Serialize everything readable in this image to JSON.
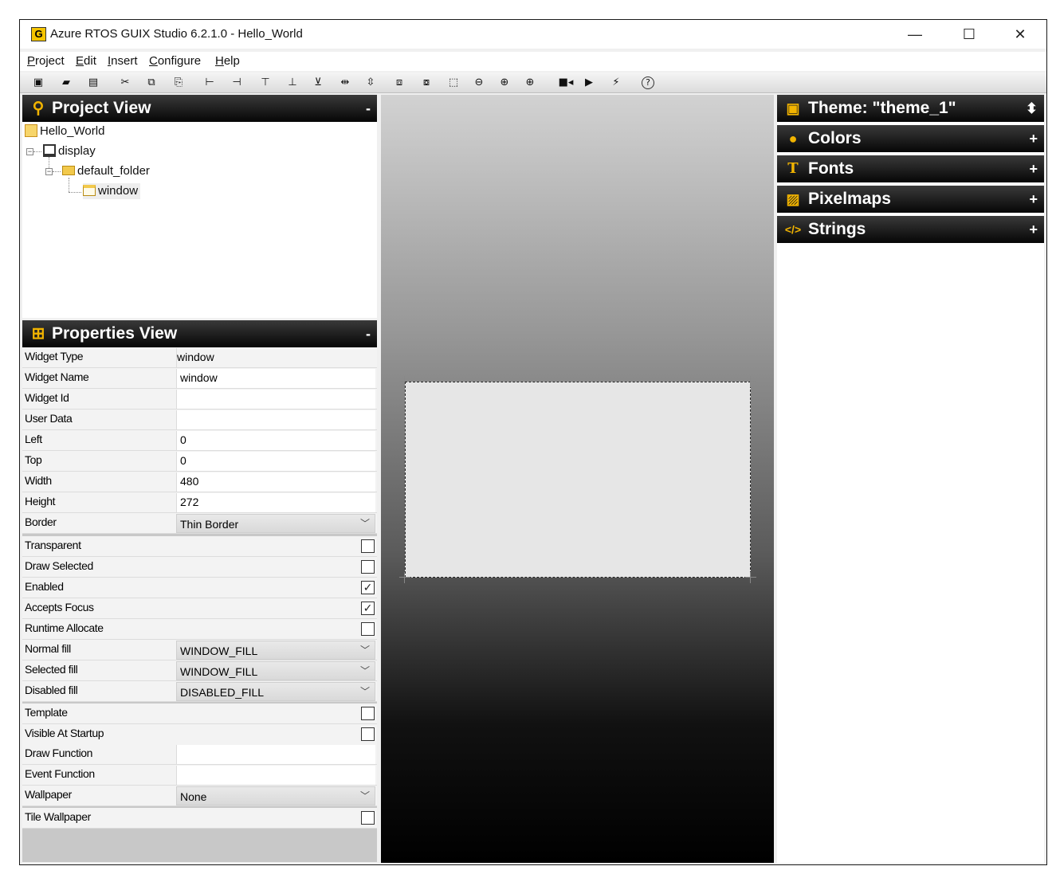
{
  "titlebar": {
    "app_icon": "G",
    "title": "Azure RTOS GUIX Studio 6.2.1.0 - Hello_World",
    "minimize": "—",
    "maximize": "☐",
    "close": "✕"
  },
  "menubar": {
    "items": [
      {
        "key": "P",
        "rest": "roject"
      },
      {
        "key": "E",
        "rest": "dit"
      },
      {
        "key": "I",
        "rest": "nsert"
      },
      {
        "key": "C",
        "rest": "onfigure"
      },
      {
        "key": "H",
        "rest": "elp"
      }
    ]
  },
  "toolbar": {
    "buttons": [
      {
        "name": "new-project",
        "glyph": "▣"
      },
      {
        "name": "open-project",
        "glyph": "▰"
      },
      {
        "name": "save-project",
        "glyph": "▤"
      },
      {
        "name": "cut",
        "glyph": "✂"
      },
      {
        "name": "copy",
        "glyph": "⧉"
      },
      {
        "name": "paste",
        "glyph": "⎘"
      },
      {
        "name": "align-left",
        "glyph": "⊢"
      },
      {
        "name": "align-right",
        "glyph": "⊣"
      },
      {
        "name": "align-top",
        "glyph": "⊤"
      },
      {
        "name": "align-bottom",
        "glyph": "⊥"
      },
      {
        "name": "vcenter",
        "glyph": "⊻"
      },
      {
        "name": "equal-width",
        "glyph": "⇹"
      },
      {
        "name": "equal-height",
        "glyph": "⇳"
      },
      {
        "name": "move-to-front",
        "glyph": "⧈"
      },
      {
        "name": "move-to-back",
        "glyph": "⧇"
      },
      {
        "name": "size-to-fit",
        "glyph": "⬚"
      },
      {
        "name": "zoom-out",
        "glyph": "⊖"
      },
      {
        "name": "zoom-in",
        "glyph": "⊕"
      },
      {
        "name": "record-macro",
        "glyph": "■◂"
      },
      {
        "name": "playback-macro",
        "glyph": "▶"
      },
      {
        "name": "run-app",
        "glyph": "⚡"
      },
      {
        "name": "about",
        "glyph": "?"
      }
    ]
  },
  "project_view": {
    "title": "Project View",
    "collapse": "-",
    "tree": {
      "root": "Hello_World",
      "display": "display",
      "folder": "default_folder",
      "widget": "window"
    }
  },
  "properties_view": {
    "title": "Properties View",
    "collapse": "-",
    "rows": {
      "widget_type": {
        "label": "Widget Type",
        "value": "window"
      },
      "widget_name": {
        "label": "Widget Name",
        "value": "window"
      },
      "widget_id": {
        "label": "Widget Id",
        "value": ""
      },
      "user_data": {
        "label": "User Data",
        "value": ""
      },
      "left": {
        "label": "Left",
        "value": "0"
      },
      "top": {
        "label": "Top",
        "value": "0"
      },
      "width": {
        "label": "Width",
        "value": "480"
      },
      "height": {
        "label": "Height",
        "value": "272"
      },
      "border": {
        "label": "Border",
        "value": "Thin Border"
      },
      "transparent": {
        "label": "Transparent",
        "checked": false
      },
      "draw_selected": {
        "label": "Draw Selected",
        "checked": false
      },
      "enabled": {
        "label": "Enabled",
        "checked": true
      },
      "accepts_focus": {
        "label": "Accepts Focus",
        "checked": true
      },
      "runtime_allocate": {
        "label": "Runtime Allocate",
        "checked": false
      },
      "normal_fill": {
        "label": "Normal fill",
        "value": "WINDOW_FILL"
      },
      "selected_fill": {
        "label": "Selected fill",
        "value": "WINDOW_FILL"
      },
      "disabled_fill": {
        "label": "Disabled fill",
        "value": "DISABLED_FILL"
      },
      "template": {
        "label": "Template",
        "checked": false
      },
      "visible_at_startup": {
        "label": "Visible At Startup",
        "checked": false
      },
      "draw_function": {
        "label": "Draw Function",
        "value": ""
      },
      "event_function": {
        "label": "Event Function",
        "value": ""
      },
      "wallpaper": {
        "label": "Wallpaper",
        "value": "None"
      },
      "tile_wallpaper": {
        "label": "Tile Wallpaper",
        "checked": false
      }
    },
    "check_glyph": "✓",
    "dropdown_glyph": "﹀"
  },
  "resource_view": {
    "sections": {
      "theme": {
        "label": "Theme: \"theme_1\"",
        "ctrl": "⬍",
        "icon": "theme-icon"
      },
      "colors": {
        "label": "Colors",
        "ctrl": "+",
        "icon": "palette-icon"
      },
      "fonts": {
        "label": "Fonts",
        "ctrl": "+",
        "icon": "font-icon"
      },
      "pixelmaps": {
        "label": "Pixelmaps",
        "ctrl": "+",
        "icon": "image-icon"
      },
      "strings": {
        "label": "Strings",
        "ctrl": "+",
        "icon": "code-icon"
      }
    }
  },
  "colors": {
    "header_dark": "#060606",
    "accent_yellow": "#f2b400",
    "canvas_window": "#e6e6e6"
  }
}
